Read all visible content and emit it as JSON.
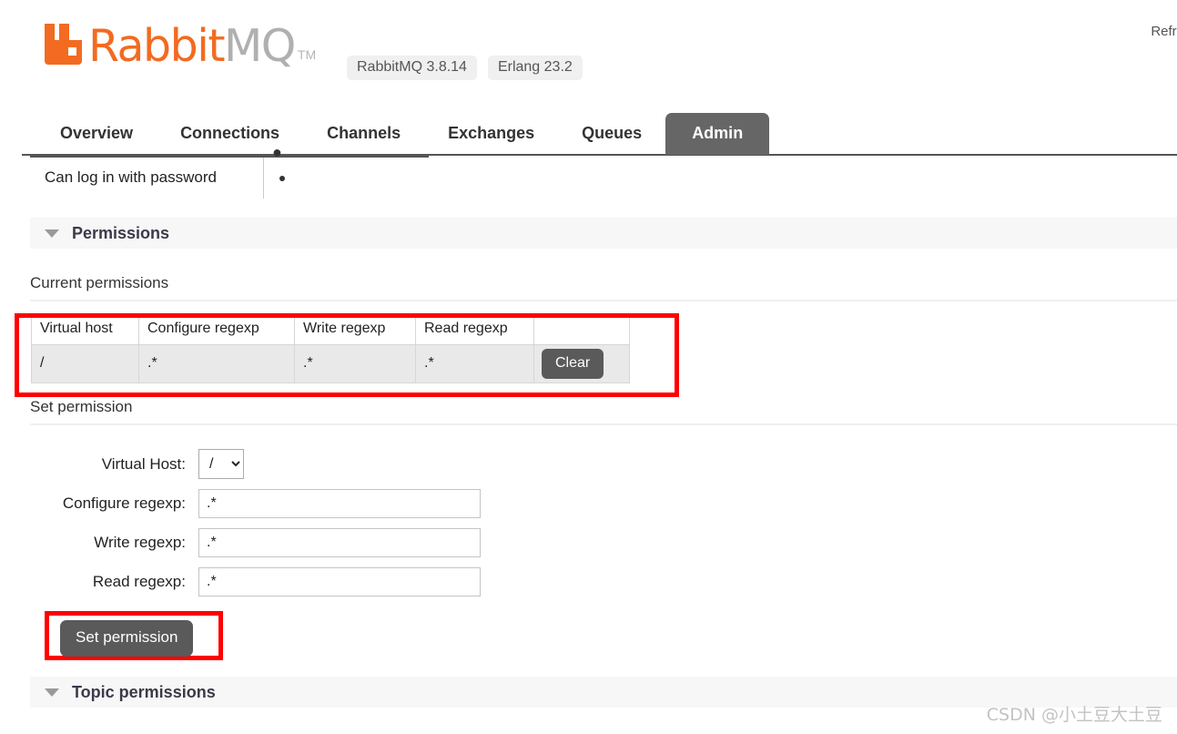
{
  "header": {
    "logo_text_primary": "Rabbit",
    "logo_text_secondary": "MQ",
    "logo_trademark": "TM",
    "badges": [
      {
        "label": "RabbitMQ 3.8.14"
      },
      {
        "label": "Erlang 23.2"
      }
    ],
    "refresh_label": "Refre"
  },
  "nav": {
    "tabs": [
      {
        "label": "Overview",
        "active": false
      },
      {
        "label": "Connections",
        "active": false
      },
      {
        "label": "Channels",
        "active": false
      },
      {
        "label": "Exchanges",
        "active": false
      },
      {
        "label": "Queues",
        "active": false
      },
      {
        "label": "Admin",
        "active": true
      }
    ]
  },
  "user_detail": {
    "can_login_label": "Can log in with password",
    "can_login_value": "•"
  },
  "permissions_section": {
    "title": "Permissions",
    "current_permissions_label": "Current permissions",
    "table": {
      "columns": [
        "Virtual host",
        "Configure regexp",
        "Write regexp",
        "Read regexp",
        ""
      ],
      "rows": [
        {
          "virtual_host": "/",
          "configure_regexp": ".*",
          "write_regexp": ".*",
          "read_regexp": ".*",
          "action_label": "Clear"
        }
      ]
    },
    "set_permission_label": "Set permission",
    "form": {
      "virtual_host_label": "Virtual Host:",
      "virtual_host_value": "/",
      "virtual_host_options": [
        "/"
      ],
      "configure_label": "Configure regexp:",
      "configure_value": ".*",
      "write_label": "Write regexp:",
      "write_value": ".*",
      "read_label": "Read regexp:",
      "read_value": ".*",
      "submit_label": "Set permission"
    }
  },
  "topic_permissions_section": {
    "title": "Topic permissions"
  },
  "watermark": {
    "text": "CSDN @小土豆大土豆"
  },
  "colors": {
    "brand_orange": "#f26b21",
    "active_tab": "#666666",
    "button_dark": "#5a5a5a",
    "highlight_red": "#fe0000",
    "table_row": "#e9e9e9"
  }
}
